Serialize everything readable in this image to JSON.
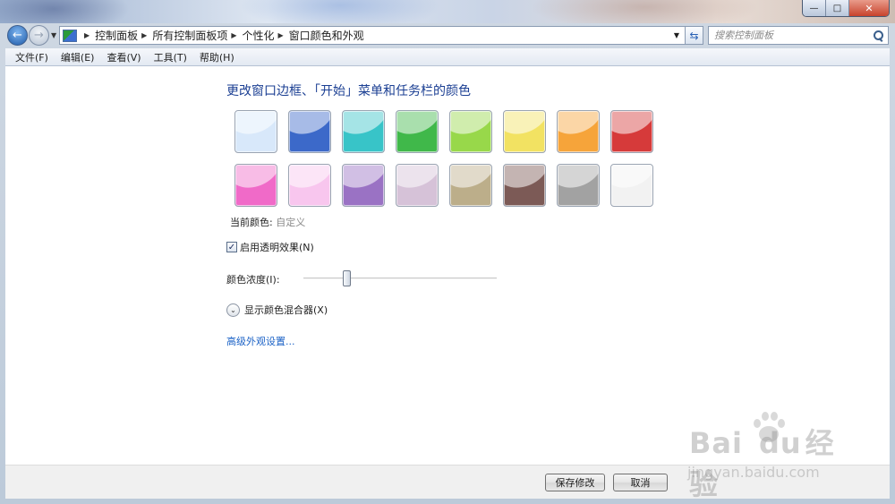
{
  "window": {
    "controls": {
      "minimize": "—",
      "maximize": "□",
      "close": "✕"
    }
  },
  "nav": {
    "back_glyph": "←",
    "forward_glyph": "→",
    "breadcrumbs": [
      "控制面板",
      "所有控制面板项",
      "个性化",
      "窗口颜色和外观"
    ],
    "search_placeholder": "搜索控制面板",
    "icons": {
      "back": "back-arrow-icon",
      "forward": "forward-arrow-icon",
      "refresh": "refresh-icon",
      "search": "search-icon",
      "folder": "control-panel-icon"
    }
  },
  "menu": [
    "文件(F)",
    "编辑(E)",
    "查看(V)",
    "工具(T)",
    "帮助(H)"
  ],
  "main": {
    "title": "更改窗口边框、「开始」菜单和任务栏的颜色",
    "swatches": [
      {
        "color": "#d8e8fa"
      },
      {
        "color": "#3c69c9"
      },
      {
        "color": "#38c4c8"
      },
      {
        "color": "#40b84a"
      },
      {
        "color": "#98d84a"
      },
      {
        "color": "#f2e262"
      },
      {
        "color": "#f6a43a"
      },
      {
        "color": "#d63a3a"
      },
      {
        "color": "#f06ac8"
      },
      {
        "color": "#f8c6ee"
      },
      {
        "color": "#9a72c4"
      },
      {
        "color": "#d6c2d8"
      },
      {
        "color": "#bcae8a"
      },
      {
        "color": "#7c5a56"
      },
      {
        "color": "#a2a2a2"
      },
      {
        "color": "#f2f2f2"
      }
    ],
    "current_color_label": "当前颜色:",
    "current_color_value": "自定义",
    "transparency_label": "启用透明效果(N)",
    "transparency_checked": true,
    "intensity_label": "颜色浓度(I):",
    "intensity_value": 0.22,
    "mixer_label": "显示颜色混合器(X)",
    "advanced_link": "高级外观设置..."
  },
  "footer": {
    "save_label": "保存修改",
    "cancel_label": "取消"
  },
  "watermark": {
    "brand": "Bai",
    "brand2": "du",
    "brand3": "经验",
    "url": "jingyan.baidu.com"
  }
}
